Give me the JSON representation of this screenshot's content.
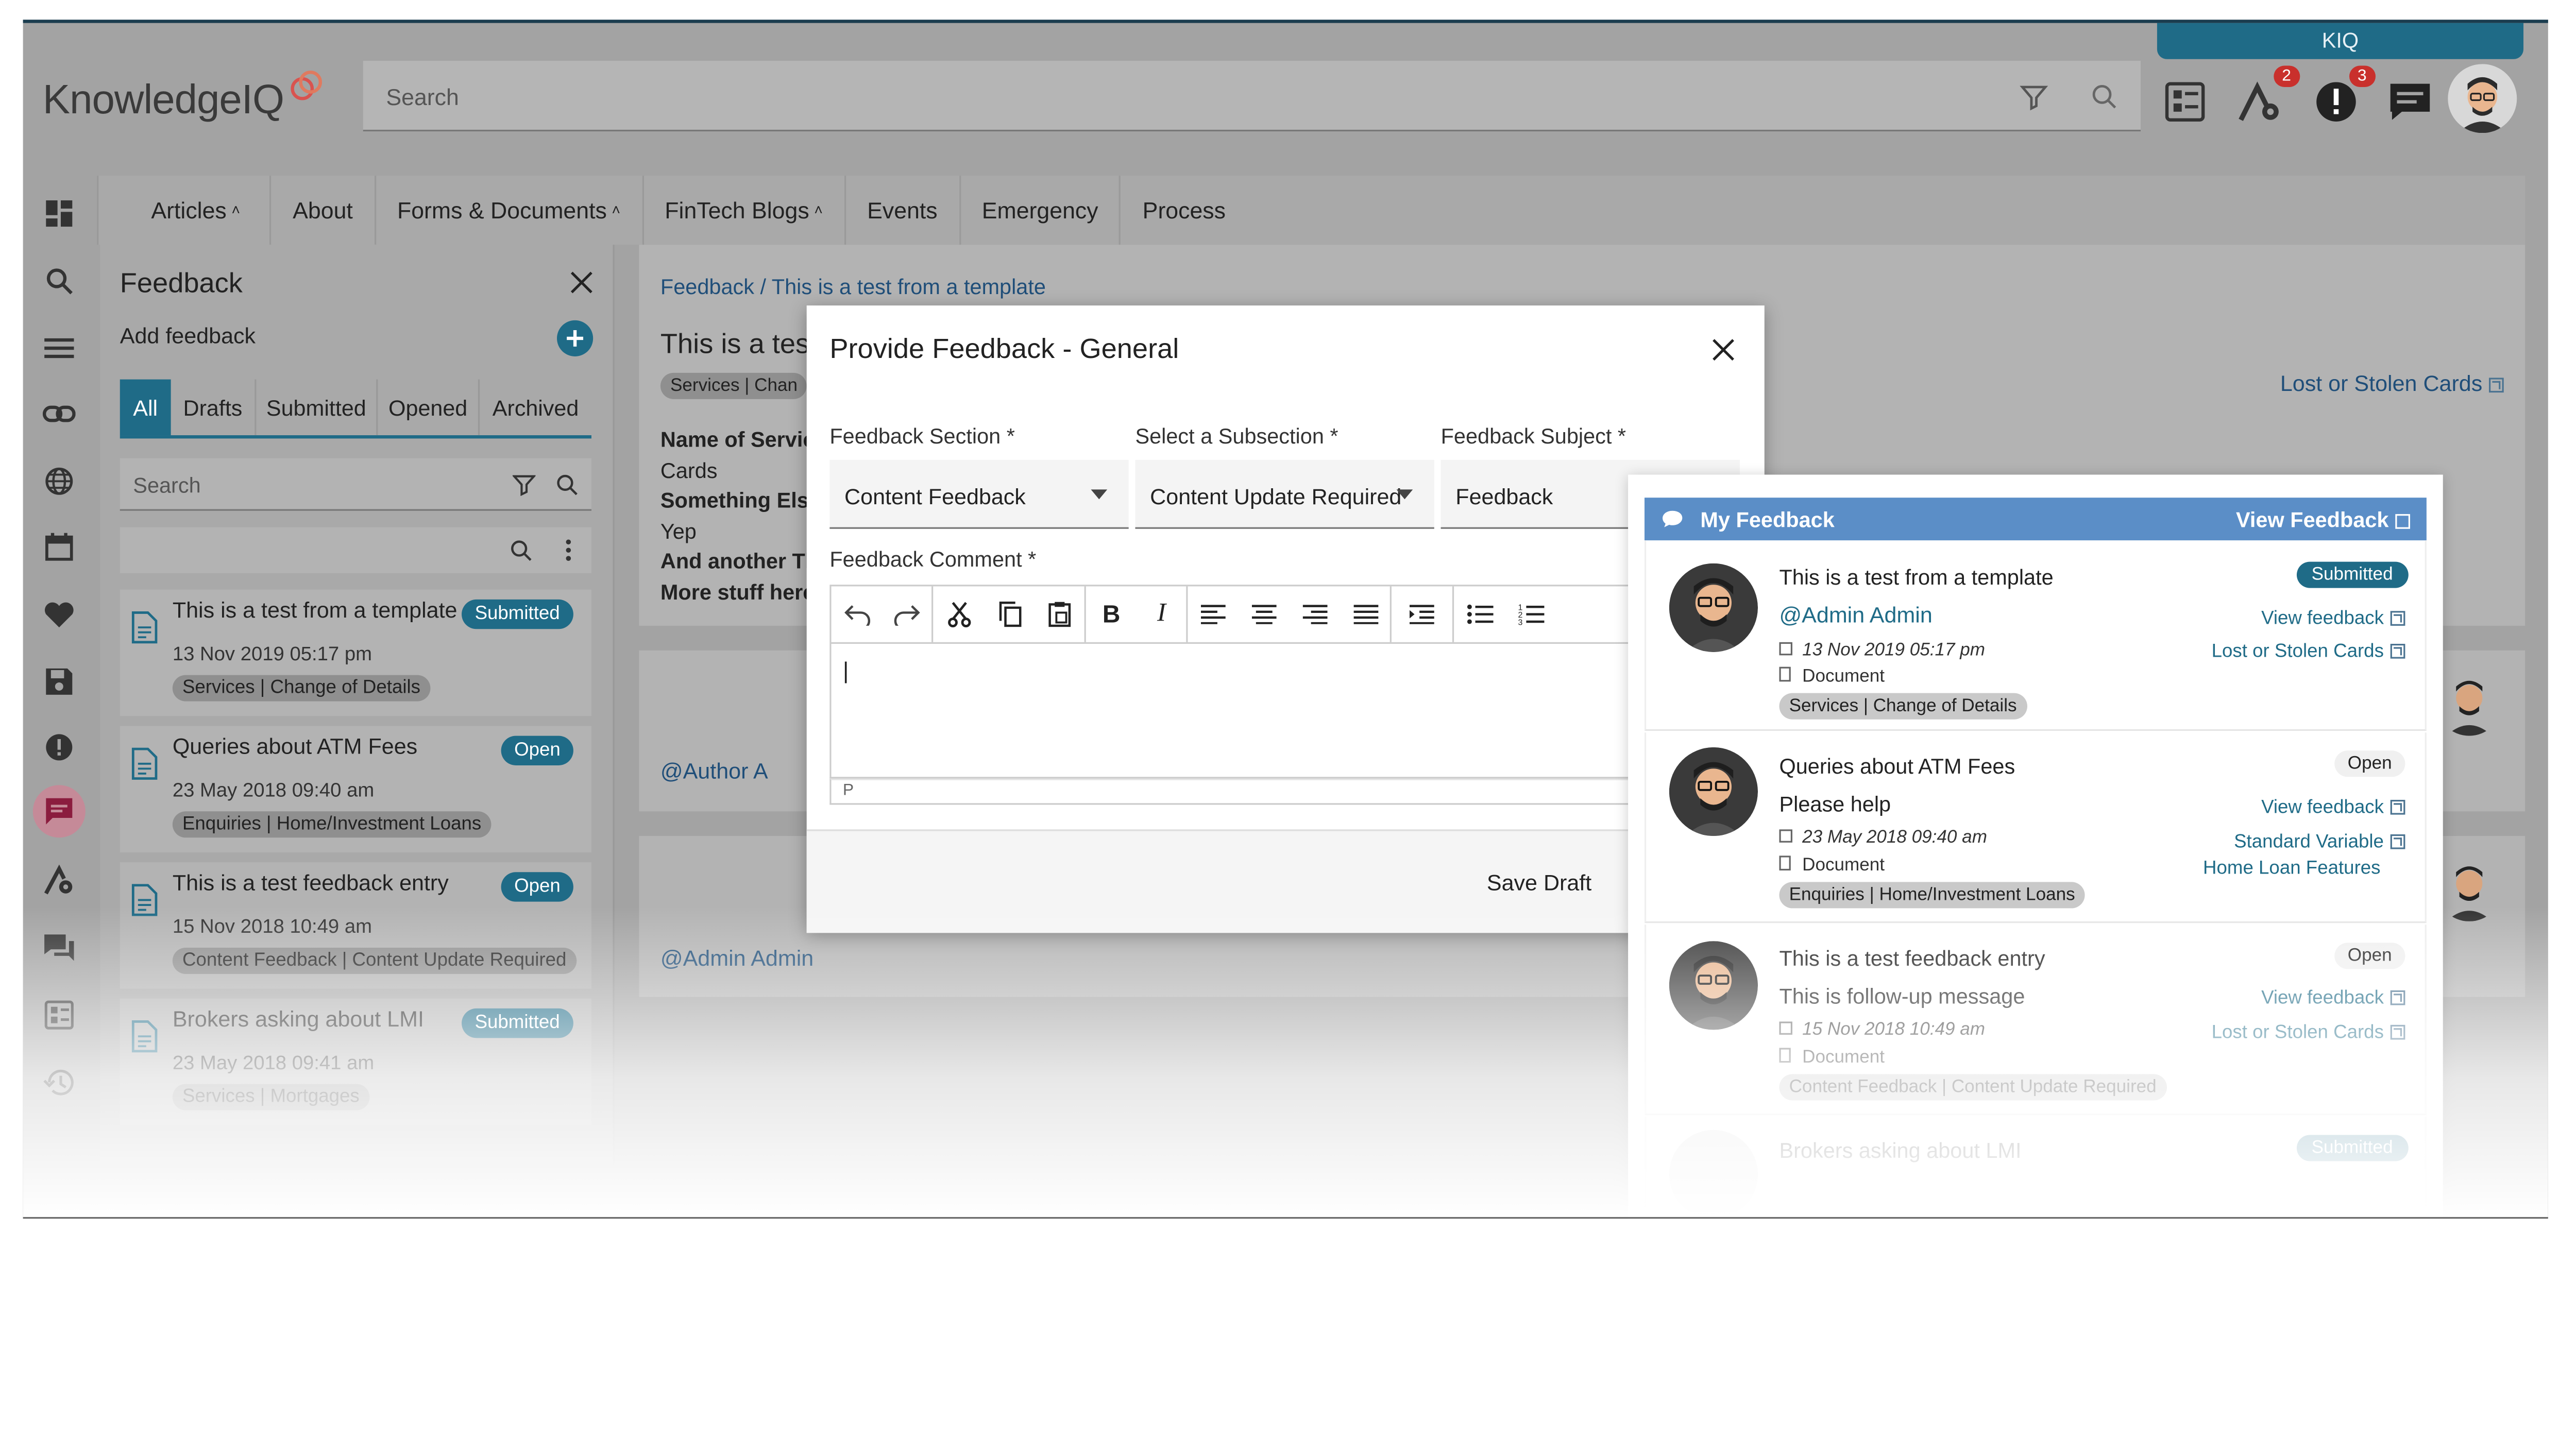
{
  "header": {
    "logo_text": "KnowledgeIQ",
    "kiq_tab": "KIQ",
    "search_placeholder": "Search",
    "badges": {
      "settings": "2",
      "alerts": "3"
    }
  },
  "nav": {
    "items": [
      "Articles",
      "About",
      "Forms & Documents",
      "FinTech Blogs",
      "Events",
      "Emergency",
      "Process"
    ]
  },
  "panel": {
    "title": "Feedback",
    "add_label": "Add feedback",
    "tabs": [
      "All",
      "Drafts",
      "Submitted",
      "Opened",
      "Archived"
    ],
    "search_placeholder": "Search",
    "items": [
      {
        "title": "This is a test from a template",
        "date": "13 Nov 2019 05:17 pm",
        "tag": "Services | Change of Details",
        "status": "Submitted"
      },
      {
        "title": "Queries about ATM Fees",
        "date": "23 May 2018 09:40 am",
        "tag": "Enquiries | Home/Investment Loans",
        "status": "Open"
      },
      {
        "title": "This is a test feedback entry",
        "date": "15 Nov 2018 10:49 am",
        "tag": "Content Feedback | Content Update Required",
        "status": "Open"
      },
      {
        "title": "Brokers asking about LMI",
        "date": "23 May 2018 09:41 am",
        "tag": "Services | Mortgages",
        "status": "Submitted"
      }
    ]
  },
  "article": {
    "breadcrumb": "Feedback / This is a test from a template",
    "title_partial": "This is a tes",
    "tag_partial": "Services | Chan",
    "lines": [
      {
        "text": "Name of Servic",
        "bold": true
      },
      {
        "text": "Cards",
        "bold": false
      },
      {
        "text": "Something Els",
        "bold": true
      },
      {
        "text": "Yep",
        "bold": false
      },
      {
        "text": "And another Th",
        "bold": true
      },
      {
        "text": "More stuff here",
        "bold": true
      }
    ],
    "related_link": "Lost or Stolen Cards",
    "author_a": "@Author A",
    "author_admin": "@Admin Admin"
  },
  "modal": {
    "title": "Provide Feedback - General",
    "section_label": "Feedback Section *",
    "section_value": "Content Feedback",
    "subsection_label": "Select a Subsection *",
    "subsection_value": "Content Update Required",
    "subject_label": "Feedback Subject *",
    "subject_value": "Feedback",
    "comment_label": "Feedback Comment *",
    "editor_cursor": "|",
    "editor_status": "P",
    "save_draft": "Save Draft"
  },
  "my_feedback": {
    "title": "My Feedback",
    "view_all": "View Feedback",
    "entries": [
      {
        "title": "This is a test from a template",
        "message": "@Admin Admin",
        "date": "13 Nov 2019 05:17 pm",
        "doc": "Document",
        "tag": "Services | Change of Details",
        "status": "Submitted",
        "links": [
          "View feedback",
          "Lost or Stolen Cards"
        ]
      },
      {
        "title": "Queries about ATM Fees",
        "message": "Please help",
        "date": "23 May 2018 09:40 am",
        "doc": "Document",
        "tag": "Enquiries | Home/Investment Loans",
        "status": "Open",
        "links": [
          "View feedback",
          "Standard Variable",
          "Home Loan Features"
        ]
      },
      {
        "title": "This is a test feedback entry",
        "message": "This is follow-up message",
        "date": "15 Nov 2018 10:49 am",
        "doc": "Document",
        "tag": "Content Feedback | Content Update Required",
        "status": "Open",
        "links": [
          "View feedback",
          "Lost or Stolen Cards"
        ]
      },
      {
        "title": "Brokers asking about LMI",
        "status": "Submitted"
      }
    ]
  },
  "colors": {
    "accent": "#1f6b87",
    "brand_red": "#d9534f",
    "panel_header": "#5b8ec7",
    "badge_red": "#c9302c"
  }
}
